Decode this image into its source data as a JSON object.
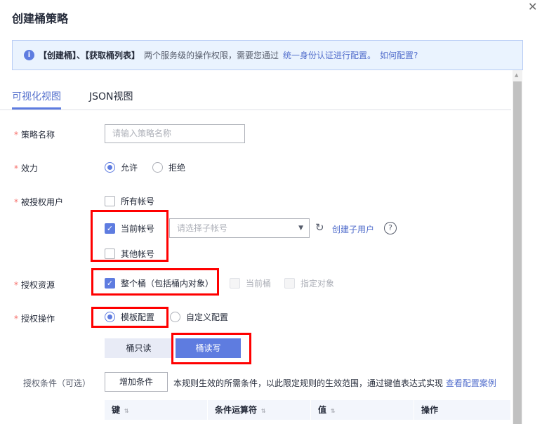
{
  "dialog": {
    "title": "创建桶策略",
    "close_icon": "close-icon"
  },
  "banner": {
    "bold": "【创建桶】、【获取桶列表】",
    "text": "两个服务级的操作权限，需要您通过",
    "link1": "统一身份认证进行配置。",
    "link2": "如何配置?"
  },
  "tabs": [
    {
      "label": "可视化视图",
      "active": true
    },
    {
      "label": "JSON视图",
      "active": false
    }
  ],
  "form": {
    "policy_name": {
      "label": "策略名称",
      "placeholder": "请输入策略名称",
      "value": ""
    },
    "effect": {
      "label": "效力",
      "options": [
        "允许",
        "拒绝"
      ],
      "selected": "允许"
    },
    "principal": {
      "label": "被授权用户",
      "all": "所有帐号",
      "current": "当前帐号",
      "other": "其他帐号",
      "select_placeholder": "请选择子帐号",
      "create_link": "创建子用户",
      "help": "?"
    },
    "resource": {
      "label": "授权资源",
      "whole": "整个桶（包括桶内对象）",
      "current": "当前桶",
      "specified": "指定对象"
    },
    "action": {
      "label": "授权操作",
      "template": "模板配置",
      "custom": "自定义配置",
      "buttons": [
        "桶只读",
        "桶读写"
      ],
      "selected": "桶读写"
    },
    "condition": {
      "label": "授权条件（可选）",
      "add_button": "增加条件",
      "desc": "本规则生效的所需条件，以此限定规则的生效范围，通过键值表达式实现",
      "link": "查看配置案例",
      "columns": [
        "键",
        "条件运算符",
        "值",
        "操作"
      ]
    }
  },
  "colors": {
    "accent": "#5e7ce0",
    "highlight": "#ff0000"
  }
}
